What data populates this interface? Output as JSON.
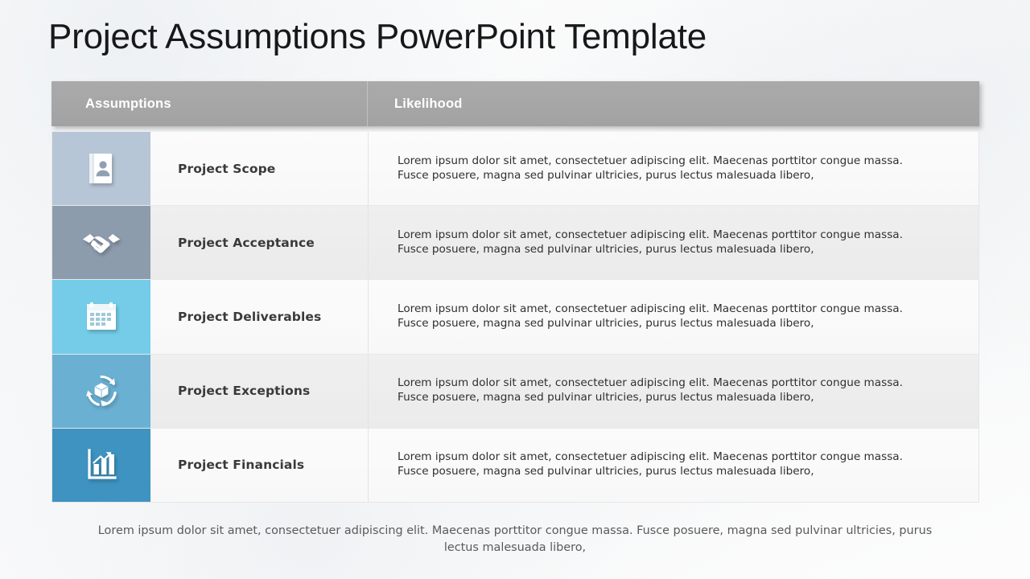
{
  "slide": {
    "title": "Project Assumptions PowerPoint Template",
    "background_color": "#fbfbfc",
    "accent_color": "#3e93c0"
  },
  "table": {
    "header": {
      "background_color": "#a6a6a6",
      "text_color": "#ffffff",
      "columns": [
        {
          "label": "Assumptions"
        },
        {
          "label": "Likelihood"
        }
      ]
    },
    "rows": [
      {
        "icon": "contact-card-icon",
        "icon_tile_color": "#b7c6d6",
        "row_background": "#fafafa",
        "label": "Project Scope",
        "description": "Lorem ipsum  dolor sit  amet, consectetuer adipiscing  elit.  Maecenas porttitor congue massa. Fusce posuere, magna sed pulvinar  ultricies,  purus lectus malesuada libero,"
      },
      {
        "icon": "handshake-icon",
        "icon_tile_color": "#8c9cad",
        "row_background": "#ededed",
        "label": "Project Acceptance",
        "description": "Lorem ipsum  dolor sit  amet, consectetuer adipiscing  elit.  Maecenas porttitor congue massa. Fusce posuere, magna sed pulvinar  ultricies,  purus lectus malesuada libero,"
      },
      {
        "icon": "calendar-icon",
        "icon_tile_color": "#74cce8",
        "row_background": "#fafafa",
        "label": "Project Deliverables",
        "description": "Lorem ipsum  dolor sit  amet, consectetuer adipiscing  elit.  Maecenas porttitor congue massa. Fusce posuere, magna sed pulvinar  ultricies,  purus lectus malesuada libero,"
      },
      {
        "icon": "package-cycle-icon",
        "icon_tile_color": "#6ab0d3",
        "row_background": "#ededed",
        "label": "Project Exceptions",
        "description": "Lorem ipsum  dolor sit  amet, consectetuer adipiscing  elit.  Maecenas porttitor congue massa. Fusce posuere, magna sed pulvinar  ultricies,  purus lectus malesuada libero,"
      },
      {
        "icon": "bar-chart-growth-icon",
        "icon_tile_color": "#3e93c0",
        "row_background": "#fafafa",
        "label": "Project Financials",
        "description": "Lorem ipsum  dolor sit  amet, consectetuer adipiscing  elit.  Maecenas porttitor congue massa. Fusce posuere, magna sed pulvinar  ultricies,  purus lectus malesuada libero,"
      }
    ]
  },
  "footer": {
    "text": "Lorem  ipsum dolor sit amet, consectetuer adipiscing elit. Maecenas porttitor congue massa. Fusce posuere,  magna sed pulvinar ultricies, purus lectus malesuada libero,"
  }
}
